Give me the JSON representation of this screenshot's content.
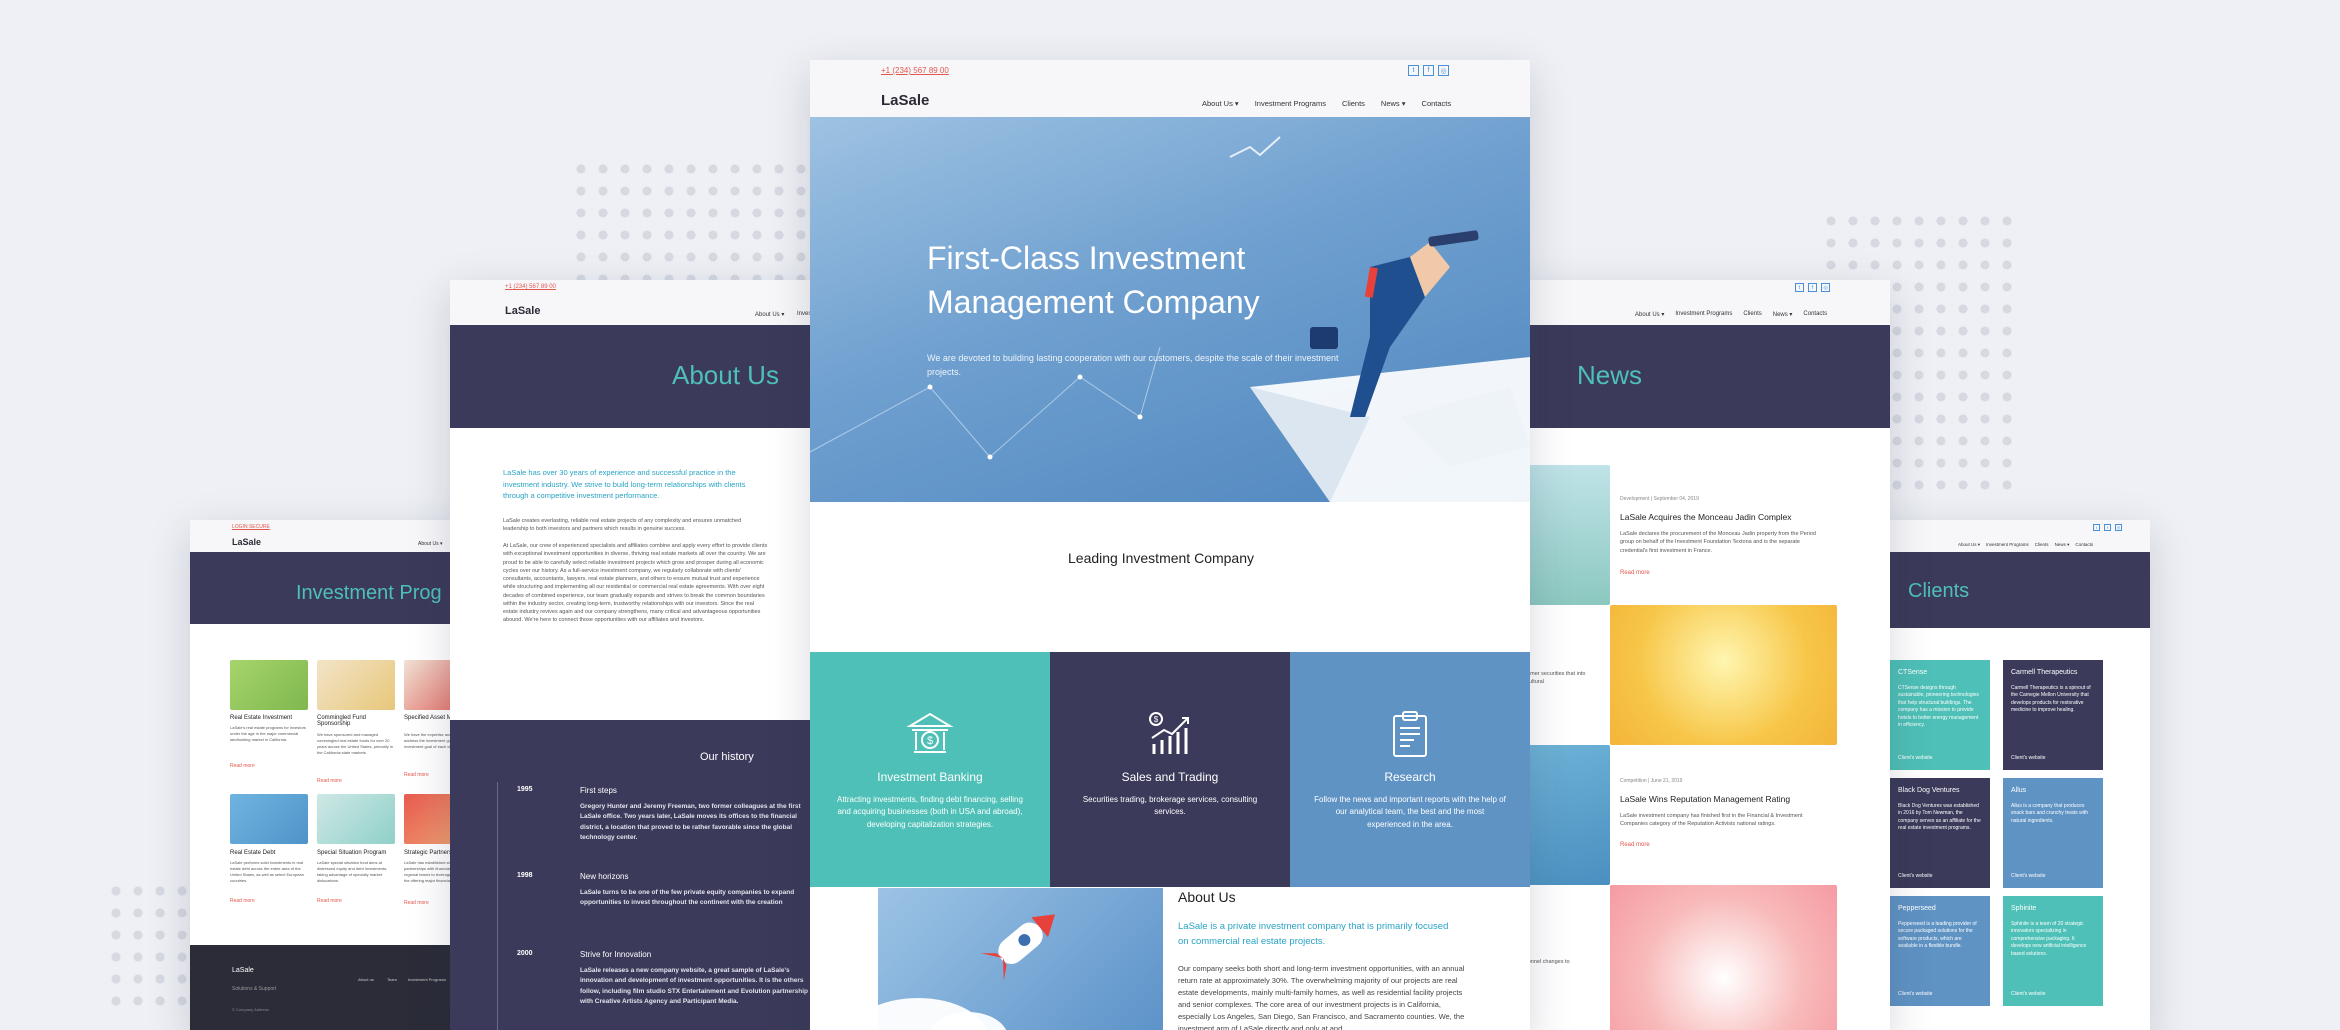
{
  "common": {
    "phone": "+1 (234) 567 89 00",
    "logo": "LaSale",
    "nav": [
      "About Us ▾",
      "Investment Programs",
      "Clients",
      "News ▾",
      "Contacts"
    ],
    "read_more": "Read more"
  },
  "hero": {
    "title_line1": "First-Class Investment",
    "title_line2": "Management Company",
    "subtitle_line1": "We are devoted to building lasting cooperation with our customers, despite the scale of their investment",
    "subtitle_line2": "projects.",
    "section_heading": "Leading Investment Company"
  },
  "services": [
    {
      "title": "Investment Banking",
      "text": "Attracting investments, finding debt financing, selling and acquiring businesses (both in USA and abroad), developing capitalization strategies.",
      "color": "#4ec0b7",
      "icon": "bank-icon"
    },
    {
      "title": "Sales and Trading",
      "text": "Securities trading, brokerage services, consulting services.",
      "color": "#3b3a5a",
      "icon": "chart-icon"
    },
    {
      "title": "Research",
      "text": "Follow the news and important reports with the help of our analytical team, the best and the most experienced in the area.",
      "color": "#5f93c4",
      "icon": "clipboard-icon"
    }
  ],
  "about_section": {
    "heading": "About Us",
    "lead_line1": "LaSale is a private investment company that is primarily focused",
    "lead_line2": "on commercial real estate projects.",
    "body": "Our company seeks both short and long-term investment opportunities, with an annual return rate at approximately 30%. The overwhelming majority of our projects are real estate developments, mainly multi-family homes, as well as residential facility projects and senior complexes. The core area of our investment projects is in California, especially Los Angeles, San Diego, San Francisco, and Sacramento counties. We, the investment arm of LaSale directly and only at and"
  },
  "about_page": {
    "banner": "About Us",
    "lead": "LaSale has over 30 years of experience and successful practice in the investment industry. We strive to build long-term relationships with clients through a competitive investment performance.",
    "p1": "LaSale creates everlasting, reliable real estate projects of any complexity and ensures unmatched leadership to both investors and partners which results in genuine success.",
    "p2": "At LaSale, our crew of experienced specialists and affiliates combine and apply every effort to provide clients with exceptional investment opportunities in diverse, thriving real estate markets all over the country. We are proud to be able to carefully select reliable investment projects which grow and prosper during all economic cycles over our history. As a full-service investment company, we regularly collaborate with clients' consultants, accountants, lawyers, real estate planners, and others to ensure mutual trust and experience while structuring and implementing all our residential or commercial real estate agreements. With over eight decades of combined experience, our team gradually expands and strives to break the common boundaries within the industry sector, creating long-term, trustworthy relationships with our investors. Since the real estate industry revives again and our company strengthens, many critical and advantageous opportunities abound. We're here to connect those opportunities with our affiliates and investors.",
    "history_heading": "Our history",
    "history": [
      {
        "year": "1995",
        "title": "First steps",
        "text": "Gregory Hunter and Jeremy Freeman, two former colleagues at the first LaSale office. Two years later, LaSale moves its offices to the financial district, a location that proved to be rather favorable since the global technology center."
      },
      {
        "year": "1998",
        "title": "New horizons",
        "text": "LaSale turns to be one of the few private equity companies to expand opportunities to invest throughout the continent with the creation"
      },
      {
        "year": "2000",
        "title": "Strive for Innovation",
        "text": "LaSale releases a new company website, a great sample of LaSale's innovation and development of investment opportunities. It is the others follow, including film studio STX Entertainment and Evolution partnership with Creative Artists Agency and Participant Media."
      }
    ]
  },
  "programs_page": {
    "top_link": "LOGIN SECURE",
    "banner": "Investment Prog",
    "nav_item": "About Us ▾",
    "items": [
      {
        "title": "Real Estate Investment",
        "text": "LaSale's real estate programs for investors under the age in the major commercial landholding market in California."
      },
      {
        "title": "Commingled Fund Sponsorship",
        "text": "We have sponsored and managed commingled real estate funds for over 20 years across the United States, primarily in the California state markets."
      },
      {
        "title": "Specified Asset Management",
        "text": "We have the expertise and strategies which address the investment goals of a broad investment goal of each client."
      },
      {
        "title": "Real Estate Debt",
        "text": "LaSale performs solid investments in real estate debt across the entire area of the United States, as well as select European countries."
      },
      {
        "title": "Special Situation Program",
        "text": "LaSale special situation fund aims at distressed equity and debt investments, taking advantage of specialty market dislocations."
      },
      {
        "title": "Strategic Partnership",
        "text": "LaSale has established strategic partnerships with financial institutions, and regional teams to leverage our expertise in the offering major financial."
      }
    ],
    "footer_logo": "LaSale",
    "footer_sub": "Solutions & Support",
    "footer_links": [
      "About us",
      "Team",
      "Investment Programs"
    ],
    "footer_small": "© Company Address"
  },
  "news_page": {
    "banner": "News",
    "items": [
      {
        "meta": "Development | September 04, 2019",
        "title": "LaSale Acquires the Monceau Jadin Complex",
        "text": "LaSale declares the procurement of the Monceau Jadin property from the Period group on behalf of the Investment Foundation Textona and is the separate credential's first investment in France."
      },
      {
        "meta": "Competition | June 21, 2019",
        "title": "LaSale Wins Reputation Management Rating",
        "text": "LaSale investment company has finished first in the Financial & Investment Companies category of the Reputation Activists national ratings."
      }
    ],
    "partial_text1": "customer securities that into agricultural",
    "partial_text2": "personnel changes to"
  },
  "clients_page": {
    "banner": "Clients",
    "nav": [
      "About Us ▾",
      "Investment Programs",
      "Clients",
      "News ▾",
      "Contacts"
    ],
    "items": [
      {
        "name": "CTSense",
        "text": "CTSense designs through sustainable, pioneering technologies that help structural buildings. The company has a mission to provide hotels to better energy management in efficiency.",
        "link": "Client's website",
        "color": "#4ec0b7"
      },
      {
        "name": "Carmell Therapeutics",
        "text": "Carmell Therapeutics is a spinout of the Carnegie Mellon University that develops products for restorative medicine to improve healing.",
        "link": "Client's website",
        "color": "#3b3a5a"
      },
      {
        "name": "Black Dog Ventures",
        "text": "Black Dog Ventures was established in 2016 by Tom Newman, the company serves as an affiliate for the real estate investment programs.",
        "link": "Client's website",
        "color": "#3b3a5a"
      },
      {
        "name": "Allus",
        "text": "Allus is a company that produces snack bars and crunchy treats with natural ingredients.",
        "link": "Client's website",
        "color": "#5f93c4"
      },
      {
        "name": "Pepperseed",
        "text": "Pepperseed is a leading provider of secure packaged solutions for the software products, which are available in a flexible bundle.",
        "link": "Client's website",
        "color": "#5f93c4"
      },
      {
        "name": "Sphinite",
        "text": "Sphinite is a team of 20 strategic innovators specializing in comprehensive packaging. It develops new artificial intelligence based solutions.",
        "link": "Client's website",
        "color": "#4ec0b7"
      }
    ]
  }
}
